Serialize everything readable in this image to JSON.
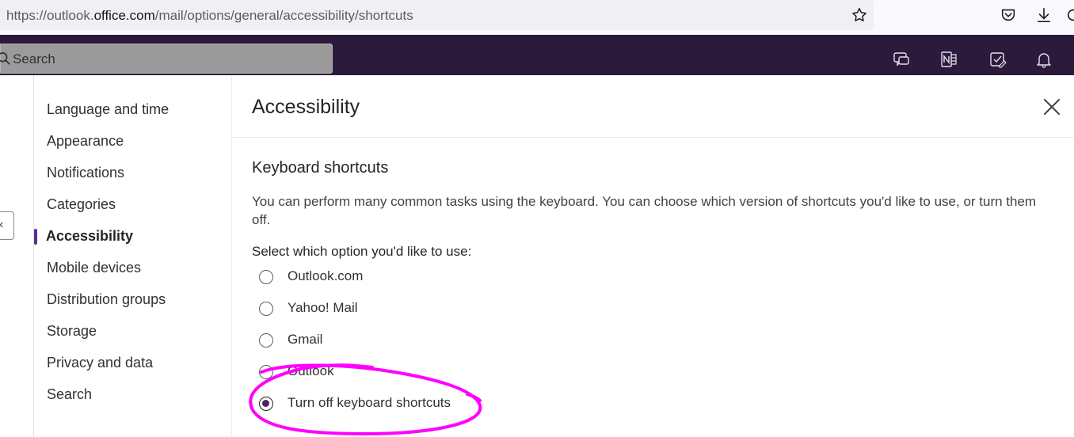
{
  "browser": {
    "url_prefix": "https://outlook.",
    "url_domain": "office.com",
    "url_path": "/mail/options/general/accessibility/shortcuts"
  },
  "header": {
    "search_placeholder": "Search",
    "bg_color": "#2b1a3b"
  },
  "settings_nav": {
    "items": [
      {
        "label": "Language and time"
      },
      {
        "label": "Appearance"
      },
      {
        "label": "Notifications"
      },
      {
        "label": "Categories"
      },
      {
        "label": "Accessibility",
        "active": true
      },
      {
        "label": "Mobile devices"
      },
      {
        "label": "Distribution groups"
      },
      {
        "label": "Storage"
      },
      {
        "label": "Privacy and data"
      },
      {
        "label": "Search"
      }
    ],
    "active_color": "#5c2e91"
  },
  "panel": {
    "title": "Accessibility",
    "section_title": "Keyboard shortcuts",
    "description": "You can perform many common tasks using the keyboard. You can choose which version of shortcuts you'd like to use, or turn them off.",
    "select_label": "Select which option you'd like to use:",
    "options": [
      {
        "label": "Outlook.com",
        "checked": false
      },
      {
        "label": "Yahoo! Mail",
        "checked": false
      },
      {
        "label": "Gmail",
        "checked": false
      },
      {
        "label": "Outlook",
        "checked": false
      },
      {
        "label": "Turn off keyboard shortcuts",
        "checked": true
      }
    ]
  },
  "annotation": {
    "color": "#ff00ff"
  },
  "icons": [
    "star-icon",
    "pocket-icon",
    "download-icon",
    "search-icon",
    "chat-icon",
    "onenote-icon",
    "todo-icon",
    "bell-icon",
    "close-icon",
    "collapse-icon"
  ]
}
